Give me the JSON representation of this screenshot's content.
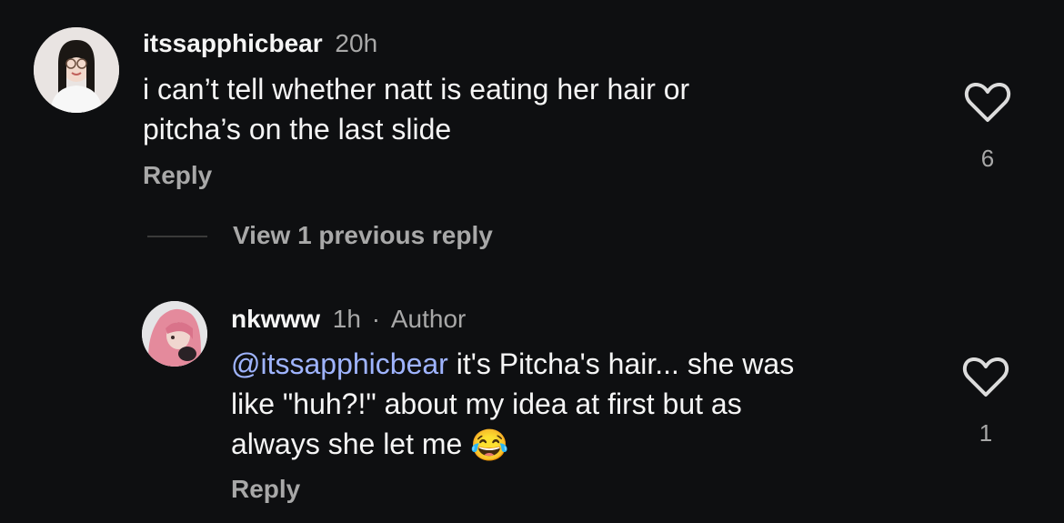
{
  "comment": {
    "username": "itssapphicbear",
    "time": "20h",
    "text": "i can’t tell whether natt is eating her hair or pitcha’s on the last slide",
    "text_line1": "i can’t tell whether natt is eating her hair or",
    "text_line2": "pitcha’s on the last slide",
    "reply_label": "Reply",
    "likes": "6"
  },
  "thread": {
    "view_replies_label": "View 1 previous reply"
  },
  "reply": {
    "username": "nkwww",
    "time": "1h",
    "separator": "·",
    "author_badge": "Author",
    "mention": "@itssapphicbear",
    "text_after_mention": " it's Pitcha's hair... she was",
    "text_line2": "like \"huh?!\" about my idea at first but as",
    "text_line3": "always she let me",
    "emoji": "😂",
    "reply_label": "Reply",
    "likes": "1"
  },
  "icons": {
    "like": "heart-outline-icon"
  },
  "colors": {
    "background": "#0e0f11",
    "primary_text": "#f5f5f5",
    "secondary_text": "#a8a8a8",
    "mention": "#9fb4ff"
  }
}
